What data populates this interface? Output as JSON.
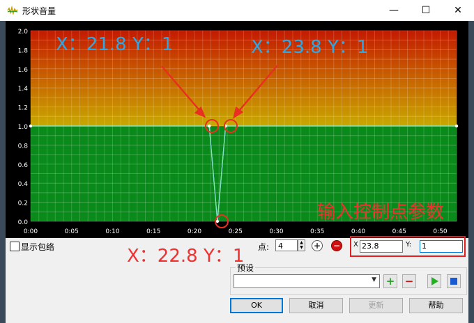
{
  "window": {
    "title": "形状音量",
    "minimize": "—",
    "maximize": "☐",
    "close": "✕",
    "icon": "waveform-icon"
  },
  "chart_data": {
    "type": "line",
    "x_ticks": [
      "0:00",
      "0:05",
      "0:10",
      "0:15",
      "0:20",
      "0:25",
      "0:30",
      "0:35",
      "0:40",
      "0:45",
      "0:50"
    ],
    "y_ticks": [
      "2.0",
      "1.8",
      "1.6",
      "1.4",
      "1.2",
      "1.0",
      "0.8",
      "0.6",
      "0.4",
      "0.2",
      "0.0"
    ],
    "xlim": [
      0,
      52
    ],
    "ylim": [
      0,
      2
    ],
    "grid": true,
    "series": [
      {
        "x": [
          0,
          21.8,
          22.8,
          23.8,
          52
        ],
        "y": [
          1,
          1,
          0,
          1,
          1
        ]
      }
    ],
    "annotations": [
      {
        "text": "X：21.8  Y：1",
        "color": "#2aa8e8"
      },
      {
        "text": "X：23.8  Y：1",
        "color": "#2aa8e8"
      },
      {
        "text": "X：22.8  Y：1",
        "color": "#f03030"
      },
      {
        "text": "输入控制点参数",
        "color": "#f03030"
      }
    ]
  },
  "controls": {
    "show_envelope_label": "显示包络",
    "show_envelope_checked": false,
    "points_label": "点:",
    "points_value": "4",
    "add_point_icon": "plus-circle-icon",
    "remove_point_icon": "minus-circle-icon",
    "x_label": "X",
    "x_value": "23.8",
    "y_label": "Y:",
    "y_value": "1"
  },
  "preset": {
    "label": "预设",
    "selected": "",
    "add_icon": "plus-icon",
    "remove_icon": "minus-icon",
    "play_icon": "play-icon",
    "stop_icon": "stop-icon"
  },
  "buttons": {
    "ok": "OK",
    "cancel": "取消",
    "update": "更新",
    "help": "帮助"
  },
  "colors": {
    "curve": "#7fe0c8",
    "top_gradient": "#cc2200",
    "mid_gradient": "#d8a000",
    "lower_fill": "#0a8a1a",
    "annotation_blue": "#2aa8e8",
    "annotation_red": "#f03030"
  }
}
